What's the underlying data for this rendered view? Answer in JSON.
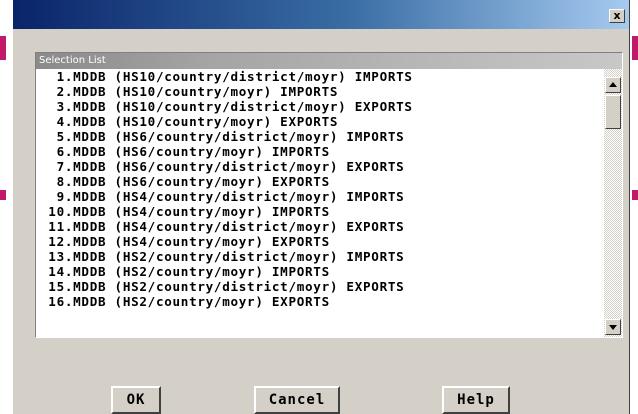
{
  "window": {
    "title": "",
    "close_glyph": "x"
  },
  "selection_list": {
    "header": "Selection List",
    "items": [
      "  1.MDDB (HS10/country/district/moyr) IMPORTS",
      "  2.MDDB (HS10/country/moyr) IMPORTS",
      "  3.MDDB (HS10/country/district/moyr) EXPORTS",
      "  4.MDDB (HS10/country/moyr) EXPORTS",
      "  5.MDDB (HS6/country/district/moyr) IMPORTS",
      "  6.MDDB (HS6/country/moyr) IMPORTS",
      "  7.MDDB (HS6/country/district/moyr) EXPORTS",
      "  8.MDDB (HS6/country/moyr) EXPORTS",
      "  9.MDDB (HS4/country/district/moyr) IMPORTS",
      " 10.MDDB (HS4/country/moyr) IMPORTS",
      " 11.MDDB (HS4/country/district/moyr) EXPORTS",
      " 12.MDDB (HS4/country/moyr) EXPORTS",
      " 13.MDDB (HS2/country/district/moyr) IMPORTS",
      " 14.MDDB (HS2/country/moyr) IMPORTS",
      " 15.MDDB (HS2/country/district/moyr) EXPORTS",
      " 16.MDDB (HS2/country/moyr) EXPORTS"
    ]
  },
  "buttons": {
    "ok": "OK",
    "cancel": "Cancel",
    "help": "Help"
  },
  "colors": {
    "title_gradient_start": "#0a246a",
    "title_gradient_end": "#a6caf0",
    "dialog_face": "#d4d0c8",
    "edge_accent": "#c21a6b"
  }
}
